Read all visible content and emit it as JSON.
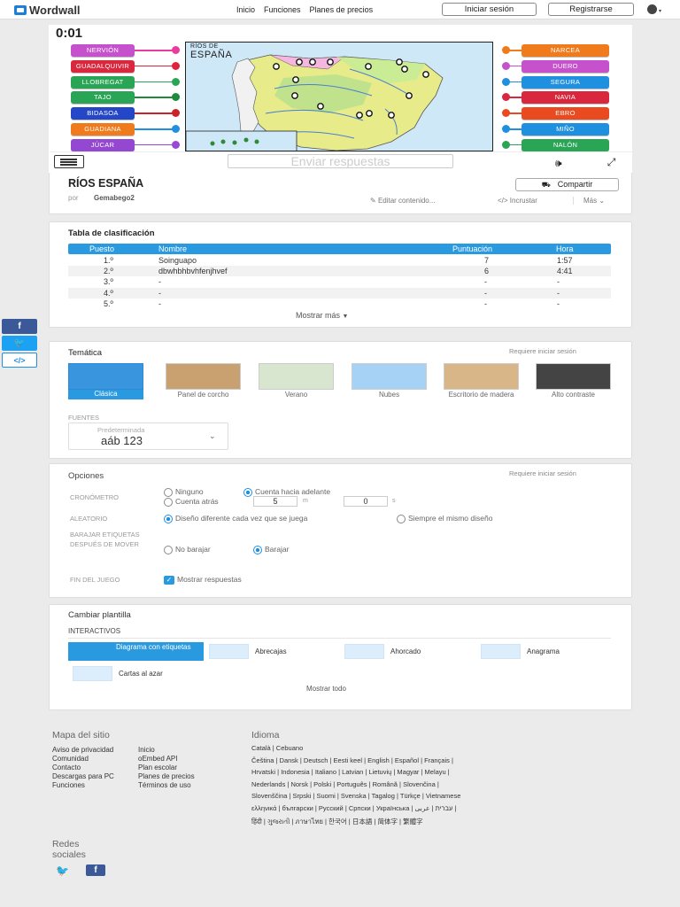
{
  "header": {
    "logo": "Wordwall",
    "nav": [
      "Inicio",
      "Funciones",
      "Planes de precios"
    ],
    "login": "Iniciar sesión",
    "register": "Registrarse"
  },
  "game": {
    "timer": "0:01",
    "map_title_small": "RÍOS DE",
    "map_title": "ESPAÑA",
    "submit": "Enviar respuestas",
    "left_labels": [
      {
        "label": "NERVIÓN",
        "color": "#c552cc",
        "dot": "#e83d9c"
      },
      {
        "label": "GUADALQUIVIR",
        "color": "#d9273e",
        "dot": "#e0223b"
      },
      {
        "label": "LLOBREGAT",
        "color": "#2aa556",
        "dot": "#2aa556"
      },
      {
        "label": "TAJO",
        "color": "#2aa556",
        "dot": "#1e8a3a"
      },
      {
        "label": "BIDASOA",
        "color": "#2447c7",
        "dot": "#cc2228"
      },
      {
        "label": "GUADIANA",
        "color": "#f07b1c",
        "dot": "#1f8fe0"
      },
      {
        "label": "JÚCAR",
        "color": "#9447d0",
        "dot": "#9a47d6"
      }
    ],
    "right_labels": [
      {
        "label": "NARCEA",
        "color": "#f07b1c",
        "dot": "#f07b1c"
      },
      {
        "label": "DUERO",
        "color": "#c552cc",
        "dot": "#c552cc"
      },
      {
        "label": "SEGURA",
        "color": "#1f8fe0",
        "dot": "#1f8fe0"
      },
      {
        "label": "NAVIA",
        "color": "#d9273e",
        "dot": "#d9273e"
      },
      {
        "label": "EBRO",
        "color": "#e94a1f",
        "dot": "#e94a1f"
      },
      {
        "label": "MIÑO",
        "color": "#1f8fe0",
        "dot": "#1f8fe0"
      },
      {
        "label": "NALÓN",
        "color": "#2aa556",
        "dot": "#2aa556"
      }
    ]
  },
  "activity": {
    "title": "RÍOS ESPAÑA",
    "by": "por",
    "author": "Gemabego2",
    "share": "Compartir",
    "edit": "Editar contenido...",
    "embed": "Incrustar",
    "more": "Más"
  },
  "leaderboard": {
    "title": "Tabla de clasificación",
    "headers": [
      "Puesto",
      "Nombre",
      "Puntuación",
      "Hora"
    ],
    "rows": [
      [
        "1.º",
        "Soinguapo",
        "7",
        "1:57"
      ],
      [
        "2.º",
        "dbwhbhbvhfenjhvef",
        "6",
        "4:41"
      ],
      [
        "3.º",
        "-",
        "-",
        "-"
      ],
      [
        "4.º",
        "-",
        "-",
        "-"
      ],
      [
        "5.º",
        "-",
        "-",
        "-"
      ]
    ],
    "show_more": "Mostrar más"
  },
  "themes": {
    "title": "Temática",
    "login_req": "Requiere iniciar sesión",
    "items": [
      "Clásica",
      "Panel de corcho",
      "Verano",
      "Nubes",
      "Escritorio de madera",
      "Alto contraste"
    ],
    "fonts_label": "FUENTES",
    "font_default": "Predeterminada",
    "font_sample": "aáb 123"
  },
  "options": {
    "title": "Opciones",
    "login_req": "Requiere iniciar sesión",
    "timer_label": "CRONÓMETRO",
    "timer_none": "Ninguno",
    "timer_up": "Cuenta hacia adelante",
    "timer_down": "Cuenta atrás",
    "minutes": "5",
    "m": "m",
    "seconds": "0",
    "s": "s",
    "random_label": "ALEATORIO",
    "random_diff": "Diseño diferente cada vez que se juega",
    "random_same": "Siempre el mismo diseño",
    "shuffle_label": "BARAJAR ETIQUETAS DESPUÉS DE MOVER",
    "shuffle_no": "No barajar",
    "shuffle_yes": "Barajar",
    "end_label": "FIN DEL JUEGO",
    "end_show": "Mostrar respuestas"
  },
  "templates": {
    "title": "Cambiar plantilla",
    "section": "INTERACTIVOS",
    "items": [
      "Diagrama con etiquetas",
      "Abrecajas",
      "Ahorcado",
      "Anagrama",
      "Cartas al azar"
    ],
    "show_all": "Mostrar todo"
  },
  "footer": {
    "sitemap": "Mapa del sitio",
    "col1": [
      "Aviso de privacidad",
      "Comunidad",
      "Contacto",
      "Descargas para PC",
      "Funciones"
    ],
    "col2": [
      "Inicio",
      "oEmbed API",
      "Plan escolar",
      "Planes de precios",
      "Términos de uso"
    ],
    "language": "Idioma",
    "social": "Redes sociales",
    "langs": [
      "Català | Cebuano",
      "Čeština | Dansk | Deutsch | Eesti keel | English | Español | Français |",
      "Hrvatski | Indonesia | Italiano | Latvian | Lietuvių | Magyar | Melayu |",
      "Nederlands | Norsk | Polski | Português | Română | Slovenčina |",
      "Slovenščina | Srpski | Suomi | Svenska | Tagalog | Türkçe | Vietnamese",
      "ελληνικά | български | Русский | Српски | Українська | עברית | عربى |",
      "हिंदी | ગુજરાતી | ภาษาไทย | 한국어 | 日本語 | 简体字 | 繁體字"
    ]
  },
  "side_share": {
    "facebook": "f",
    "twitter": "t",
    "embed": "</>"
  }
}
